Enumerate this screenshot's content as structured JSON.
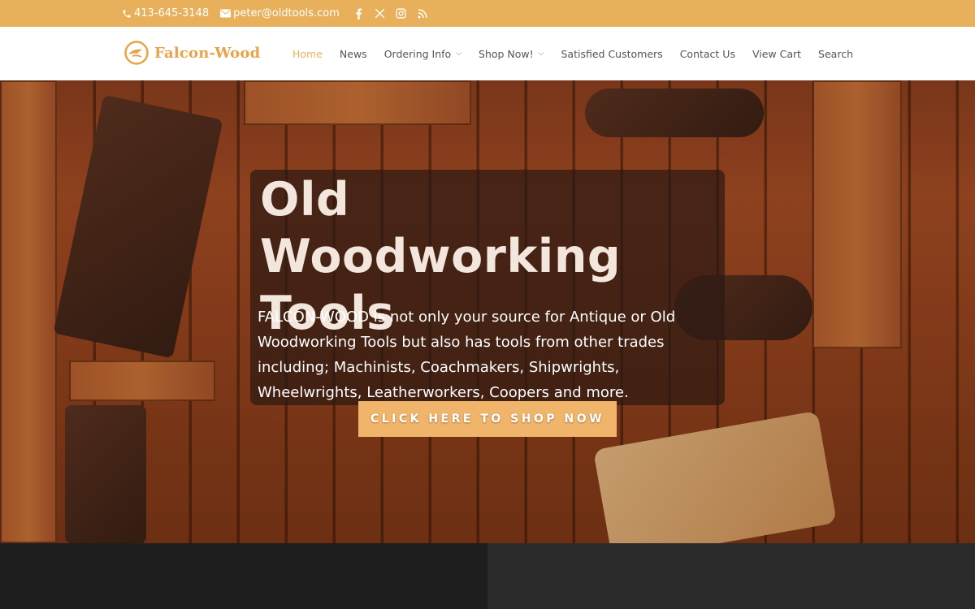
{
  "topbar": {
    "phone": "413-645-3148",
    "email": "peter@oldtools.com",
    "social_icons": [
      "facebook-icon",
      "x-icon",
      "instagram-icon",
      "rss-icon"
    ],
    "bg_color": "#e9b05c"
  },
  "header": {
    "logo_text": "Falcon-Wood",
    "nav": [
      {
        "label": "Home",
        "active": true,
        "dropdown": false
      },
      {
        "label": "News",
        "active": false,
        "dropdown": false
      },
      {
        "label": "Ordering Info",
        "active": false,
        "dropdown": true
      },
      {
        "label": "Shop Now!",
        "active": false,
        "dropdown": true
      },
      {
        "label": "Satisfied Customers",
        "active": false,
        "dropdown": false
      },
      {
        "label": "Contact Us",
        "active": false,
        "dropdown": false
      },
      {
        "label": "View Cart",
        "active": false,
        "dropdown": false
      },
      {
        "label": "Search",
        "active": false,
        "dropdown": false
      }
    ],
    "accent_color": "#e9b05c"
  },
  "hero": {
    "title": "Old Woodworking Tools",
    "description": "FALCON-WOOD is not only your source for Antique or Old Woodworking Tools but also has tools from other trades including; Machinists, Coachmakers, Shipwrights, Wheelwrights, Leatherworkers, Coopers and more.",
    "cta_label": "CLICK HERE TO SHOP NOW",
    "cta_color": "#f0b46a"
  }
}
